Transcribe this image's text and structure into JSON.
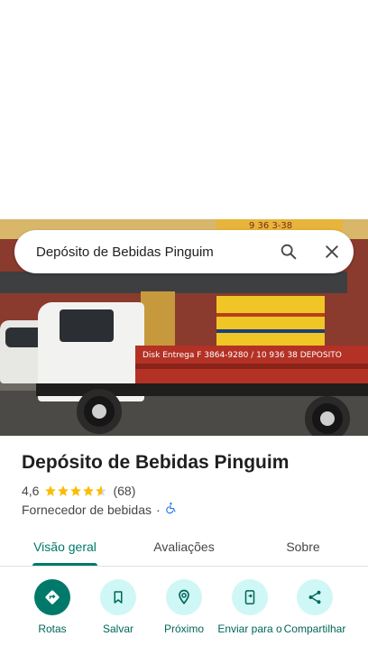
{
  "search": {
    "query": "Depósito de Bebidas Pinguim"
  },
  "photo": {
    "sign_text": "9 36 3-38",
    "truck_text": "Disk Entrega F 3864-9280 / 10 936 38     DEPOSITO"
  },
  "place": {
    "name": "Depósito de Bebidas Pinguim",
    "rating": "4,6",
    "rating_value": 4.6,
    "review_count": "(68)",
    "category": "Fornecedor de bebidas",
    "separator": "·"
  },
  "tabs": [
    {
      "label": "Visão geral",
      "active": true
    },
    {
      "label": "Avaliações",
      "active": false
    },
    {
      "label": "Sobre",
      "active": false
    }
  ],
  "actions": [
    {
      "label": "Rotas",
      "icon": "directions-icon"
    },
    {
      "label": "Salvar",
      "icon": "bookmark-icon"
    },
    {
      "label": "Próximo",
      "icon": "nearby-icon"
    },
    {
      "label": "Enviar para o",
      "icon": "send-to-phone-icon"
    },
    {
      "label": "Compartilhar",
      "icon": "share-icon"
    }
  ],
  "colors": {
    "accent": "#00796b",
    "star": "#fbbc04",
    "chip_bg": "#cff7f5"
  }
}
